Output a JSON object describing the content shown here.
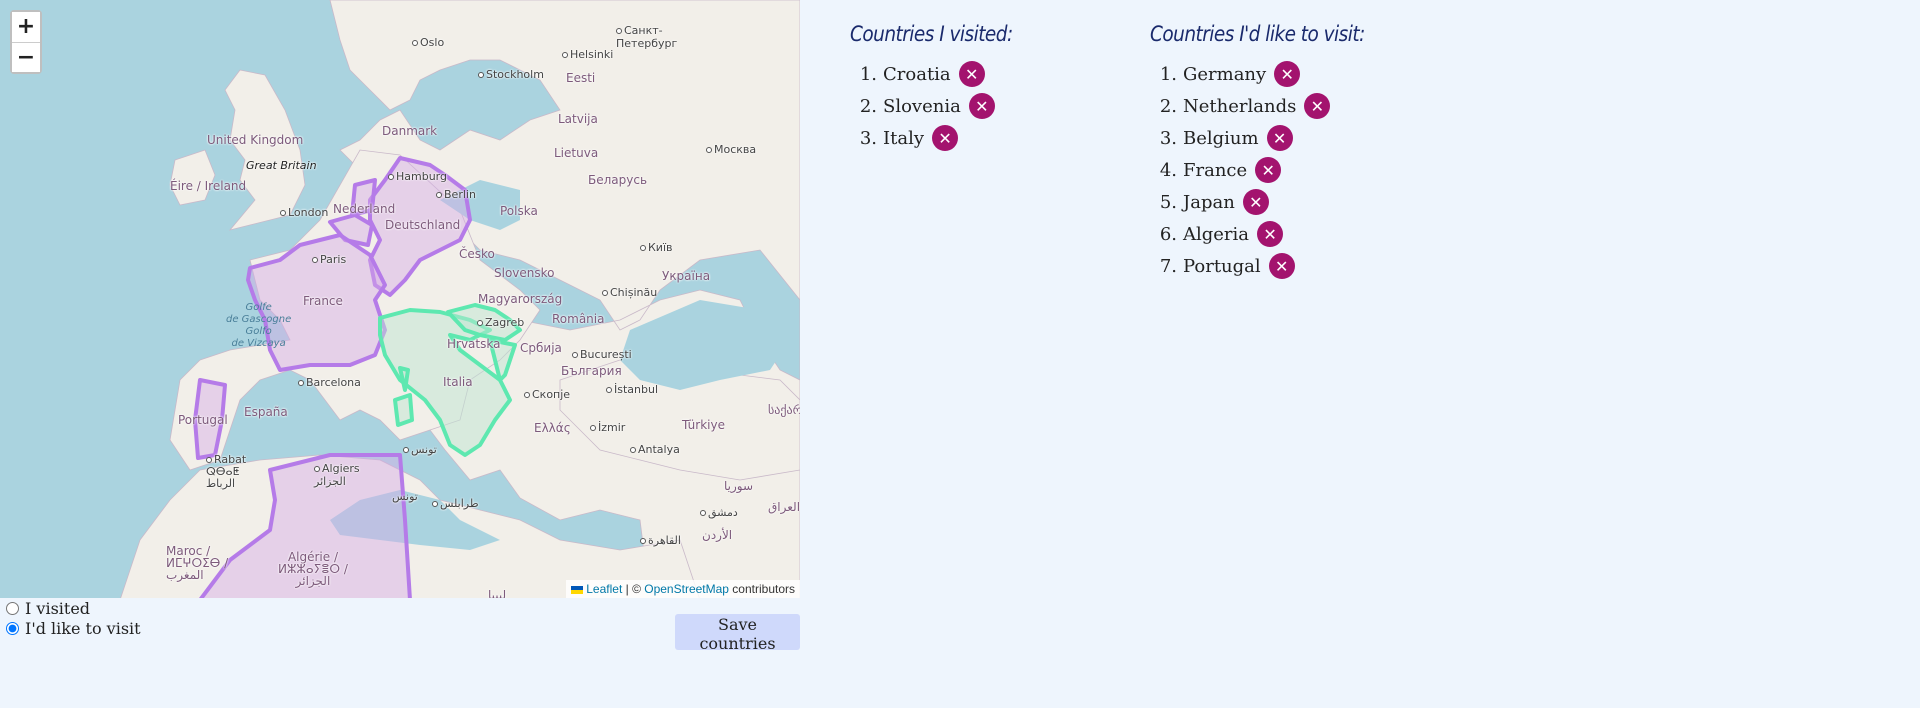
{
  "map": {
    "zoom_in_label": "+",
    "zoom_out_label": "−",
    "attribution": {
      "leaflet": "Leaflet",
      "separator": " | © ",
      "osm": "OpenStreetMap",
      "suffix": " contributors"
    },
    "labels": {
      "oslo": "Oslo",
      "stockholm": "Stockholm",
      "helsinki": "Helsinki",
      "spb": "Санкт-\nПетербург",
      "eesti": "Eesti",
      "latvija": "Latvija",
      "lietuva": "Lietuva",
      "moskva": "Москва",
      "danmark": "Danmark",
      "uk": "United Kingdom",
      "gb": "Great Britain",
      "ireland": "Éire / Ireland",
      "london": "London",
      "hamburg": "Hamburg",
      "berlin": "Berlin",
      "nederland": "Nederland",
      "deutschland": "Deutschland",
      "polska": "Polska",
      "belarus": "Беларусь",
      "paris": "Paris",
      "cesko": "Česko",
      "slovensko": "Slovensko",
      "kyiv": "Київ",
      "ukraina": "Україна",
      "chisinau": "Chișinău",
      "magyar": "Magyarország",
      "france": "France",
      "gascogne": "Golfe\nde Gascogne\nGolfo\nde Vizcaya",
      "zagreb": "Zagreb",
      "hrvatska": "Hrvatska",
      "romania": "România",
      "srbija": "Србија",
      "bucuresti": "București",
      "bulgaria": "България",
      "barcelona": "Barcelona",
      "italia": "Italia",
      "skopje": "Скопје",
      "istanbul": "İstanbul",
      "sakartvelo": "საქართველო",
      "espana": "España",
      "portugal": "Portugal",
      "ellada": "Ελλάς",
      "izmir": "İzmir",
      "turkiye": "Türkiye",
      "tunis": "تونس",
      "rabat": "Rabat\nⵕⴱⴰⵟ\nالرباط",
      "algiers": "Algiers\nالجزائر",
      "antalya": "Antalya",
      "tunis2": "تونس",
      "tarabulus": "طرابلس",
      "suria": "سوريا",
      "dimashq": "دمشق",
      "iraq": "العراق",
      "urdun": "الأردن",
      "qahira": "القاهرة",
      "maroc": "Maroc /\nⵍⵎⵖⵔⵉⴱ /\nالمغرب",
      "algerie": "Algérie /\nⵍⵣⵣⴰⵢⴻⵔ /\nالجزائر",
      "libya": "ليبيا"
    }
  },
  "mode": {
    "visited_label": "I visited",
    "wish_label": "I'd like to visit",
    "selected": "wish"
  },
  "save_button": "Save countries",
  "visited": {
    "title": "Countries I visited:",
    "items": [
      "Croatia",
      "Slovenia",
      "Italy"
    ]
  },
  "wishlist": {
    "title": "Countries I'd like to visit:",
    "items": [
      "Germany",
      "Netherlands",
      "Belgium",
      "France",
      "Japan",
      "Algeria",
      "Portugal"
    ]
  },
  "colors": {
    "visited_outline": "#5ee8b0",
    "wish_outline": "#b57be8",
    "remove_button": "#a3136e"
  },
  "icons": {
    "remove": "close-icon"
  }
}
